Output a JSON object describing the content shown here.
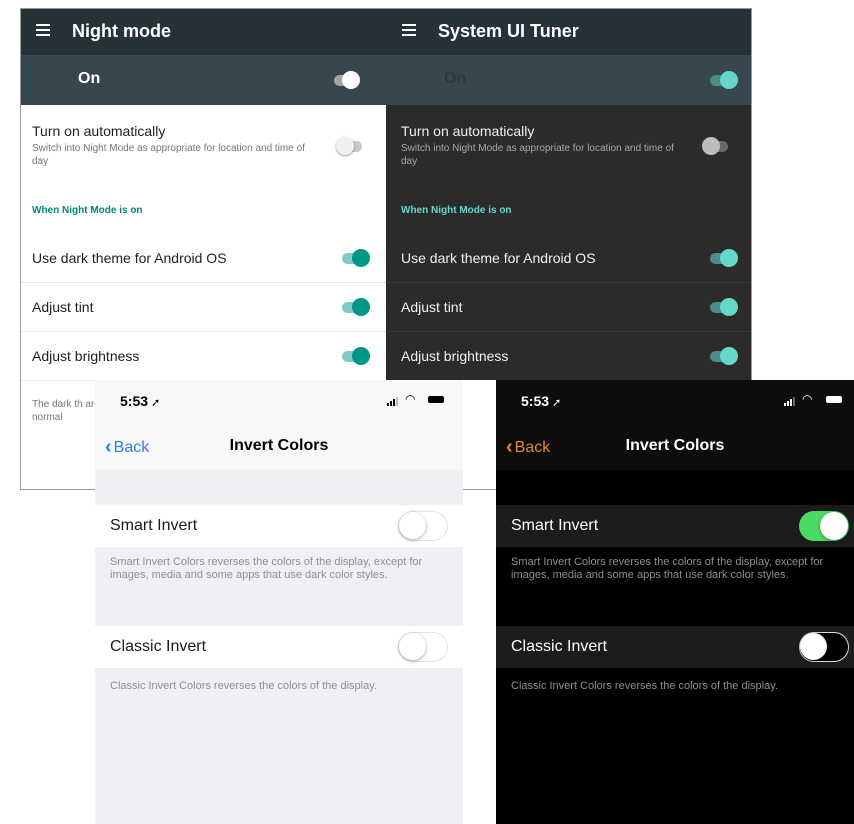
{
  "android_light": {
    "title": "Night mode",
    "master_label": "On",
    "master_on": true,
    "auto": {
      "title": "Turn on automatically",
      "subtitle": "Switch into Night Mode as appropriate for location and time of day",
      "on": false
    },
    "section_header": "When Night Mode is on",
    "rows": [
      {
        "label": "Use dark theme for Android OS",
        "on": true
      },
      {
        "label": "Adjust tint",
        "on": true
      },
      {
        "label": "Adjust brightness",
        "on": true
      }
    ],
    "footer_text": "The dark th are normal"
  },
  "android_dark": {
    "title": "System UI Tuner",
    "master_label": "On",
    "master_on": true,
    "auto": {
      "title": "Turn on automatically",
      "subtitle": "Switch into Night Mode as appropriate for location and time of day",
      "on": false
    },
    "section_header": "When Night Mode is on",
    "rows": [
      {
        "label": "Use dark theme for Android OS",
        "on": true
      },
      {
        "label": "Adjust tint",
        "on": true
      },
      {
        "label": "Adjust brightness",
        "on": true
      }
    ]
  },
  "ios_light": {
    "time": "5:53",
    "back_label": "Back",
    "title": "Invert Colors",
    "smart_invert": {
      "label": "Smart Invert",
      "on": false,
      "description": "Smart Invert Colors reverses the colors of the display, except for images, media and some apps that use dark color styles."
    },
    "classic_invert": {
      "label": "Classic Invert",
      "on": false,
      "description": "Classic Invert Colors reverses the colors of the display."
    }
  },
  "ios_dark": {
    "time": "5:53",
    "back_label": "Back",
    "title": "Invert Colors",
    "smart_invert": {
      "label": "Smart Invert",
      "on": true,
      "description": "Smart Invert Colors reverses the colors of the display, except for images, media and some apps that use dark color styles."
    },
    "classic_invert": {
      "label": "Classic Invert",
      "on": false,
      "description": "Classic Invert Colors reverses the colors of the display."
    }
  },
  "colors": {
    "android_toolbar": "#263238",
    "android_master_bar": "#37474f",
    "android_accent": "#009688",
    "ios_tint_light": "#2f7de1",
    "ios_tint_dark": "#e08a2a",
    "ios_switch_on": "#4cd964"
  },
  "icons": [
    "menu-icon",
    "location-arrow-icon",
    "signal-icon",
    "wifi-icon",
    "battery-icon",
    "chevron-left-icon"
  ]
}
